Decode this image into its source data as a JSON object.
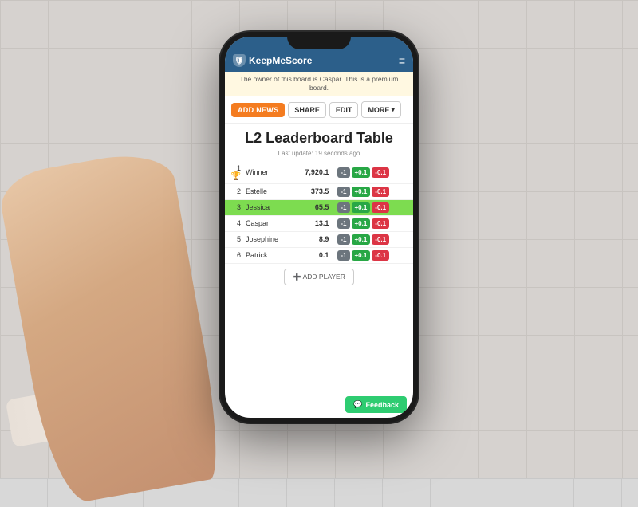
{
  "scene": {
    "background": "#d6d2cf"
  },
  "app": {
    "brand": "KeepMeScore",
    "navbar_bg": "#2c5f8a"
  },
  "notice": {
    "text": "The owner of this board is Caspar. This is a premium board."
  },
  "actions": {
    "add_news_label": "ADD NEWS",
    "share_label": "SHARE",
    "edit_label": "EDIT",
    "more_label": "MORE"
  },
  "leaderboard": {
    "title": "L2 Leaderboard Table",
    "last_update": "Last update: 19 seconds ago",
    "players": [
      {
        "rank": "1",
        "trophy": true,
        "name": "Winner",
        "score": "7,920.1",
        "highlighted": false
      },
      {
        "rank": "2",
        "trophy": false,
        "name": "Estelle",
        "score": "373.5",
        "highlighted": false
      },
      {
        "rank": "3",
        "trophy": false,
        "name": "Jessica",
        "score": "65.5",
        "highlighted": true
      },
      {
        "rank": "4",
        "trophy": false,
        "name": "Caspar",
        "score": "13.1",
        "highlighted": false
      },
      {
        "rank": "5",
        "trophy": false,
        "name": "Josephine",
        "score": "8.9",
        "highlighted": false
      },
      {
        "rank": "6",
        "trophy": false,
        "name": "Patrick",
        "score": "0.1",
        "highlighted": false
      }
    ],
    "btn_minus": "-1",
    "btn_plus": "+0.1",
    "btn_neg": "-0.1",
    "add_player_label": "➕ ADD PLAYER"
  },
  "feedback": {
    "label": "Feedback"
  }
}
